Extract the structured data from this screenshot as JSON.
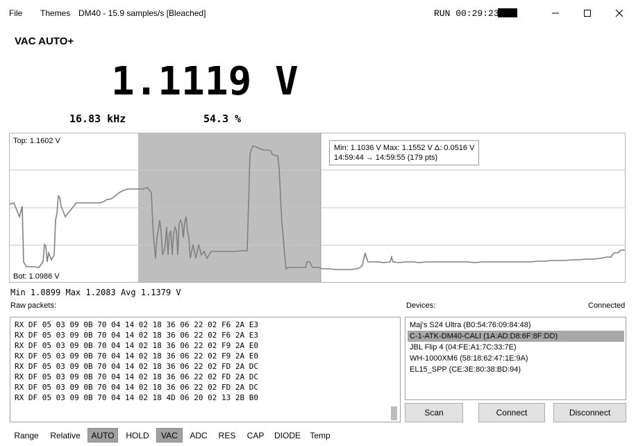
{
  "titlebar": {
    "menu_file": "File",
    "menu_themes": "Themes",
    "title": "DM40 - 15.9 samples/s [Bleached]",
    "run_status": "RUN 00:29:23"
  },
  "meter": {
    "mode": "VAC AUTO+",
    "reading": "1.1119 V",
    "frequency": "16.83 kHz",
    "duty": "54.3 %"
  },
  "plot": {
    "top_label": "Top: 1.1602 V",
    "bot_label": "Bot: 1.0986 V",
    "tooltip_line1": "Min: 1.1036 V  Max: 1.1552 V  Δ: 0.0516 V",
    "tooltip_line2": "14:59:44 → 14:59:55  (179 pts)"
  },
  "stats": {
    "text": "Min 1.0899  Max 1.2083  Avg 1.1379 V"
  },
  "raw": {
    "label": "Raw packets:",
    "lines": [
      "RX DF 05 03 09 0B 70 04 14 02 18 36 06 22 02 F6 2A E3",
      "RX DF 05 03 09 0B 70 04 14 02 18 36 06 22 02 F6 2A E3",
      "RX DF 05 03 09 0B 70 04 14 02 18 36 06 22 02 F9 2A E0",
      "RX DF 05 03 09 0B 70 04 14 02 18 36 06 22 02 F9 2A E0",
      "RX DF 05 03 09 0B 70 04 14 02 18 36 06 22 02 FD 2A DC",
      "RX DF 05 03 09 0B 70 04 14 02 18 36 06 22 02 FD 2A DC",
      "RX DF 05 03 09 0B 70 04 14 02 18 36 06 22 02 FD 2A DC",
      "RX DF 05 03 09 0B 70 04 14 02 18 4D 06 20 02 13 2B B0"
    ]
  },
  "devices": {
    "label": "Devices:",
    "status": "Connected",
    "items": [
      "Maj's S24 Ultra (B0:54:76:09:84:48)",
      "C-1-ATK-DM40-CALI (1A:AD:D8:6F:8F:DD)",
      "JBL Flip 4 (04:FE:A1:7C:33:7E)",
      "WH-1000XM6 (58:18:62:47:1E:9A)",
      "EL15_SPP (CE:3E:80:38:BD:94)"
    ],
    "selected_index": 1
  },
  "buttons": {
    "scan": "Scan",
    "connect": "Connect",
    "disconnect": "Disconnect"
  },
  "modes": {
    "range": "Range",
    "relative": "Relative",
    "auto": "AUTO",
    "hold": "HOLD",
    "vac": "VAC",
    "adc": "ADC",
    "res": "RES",
    "cap": "CAP",
    "diode": "DIODE",
    "temp": "Temp"
  }
}
